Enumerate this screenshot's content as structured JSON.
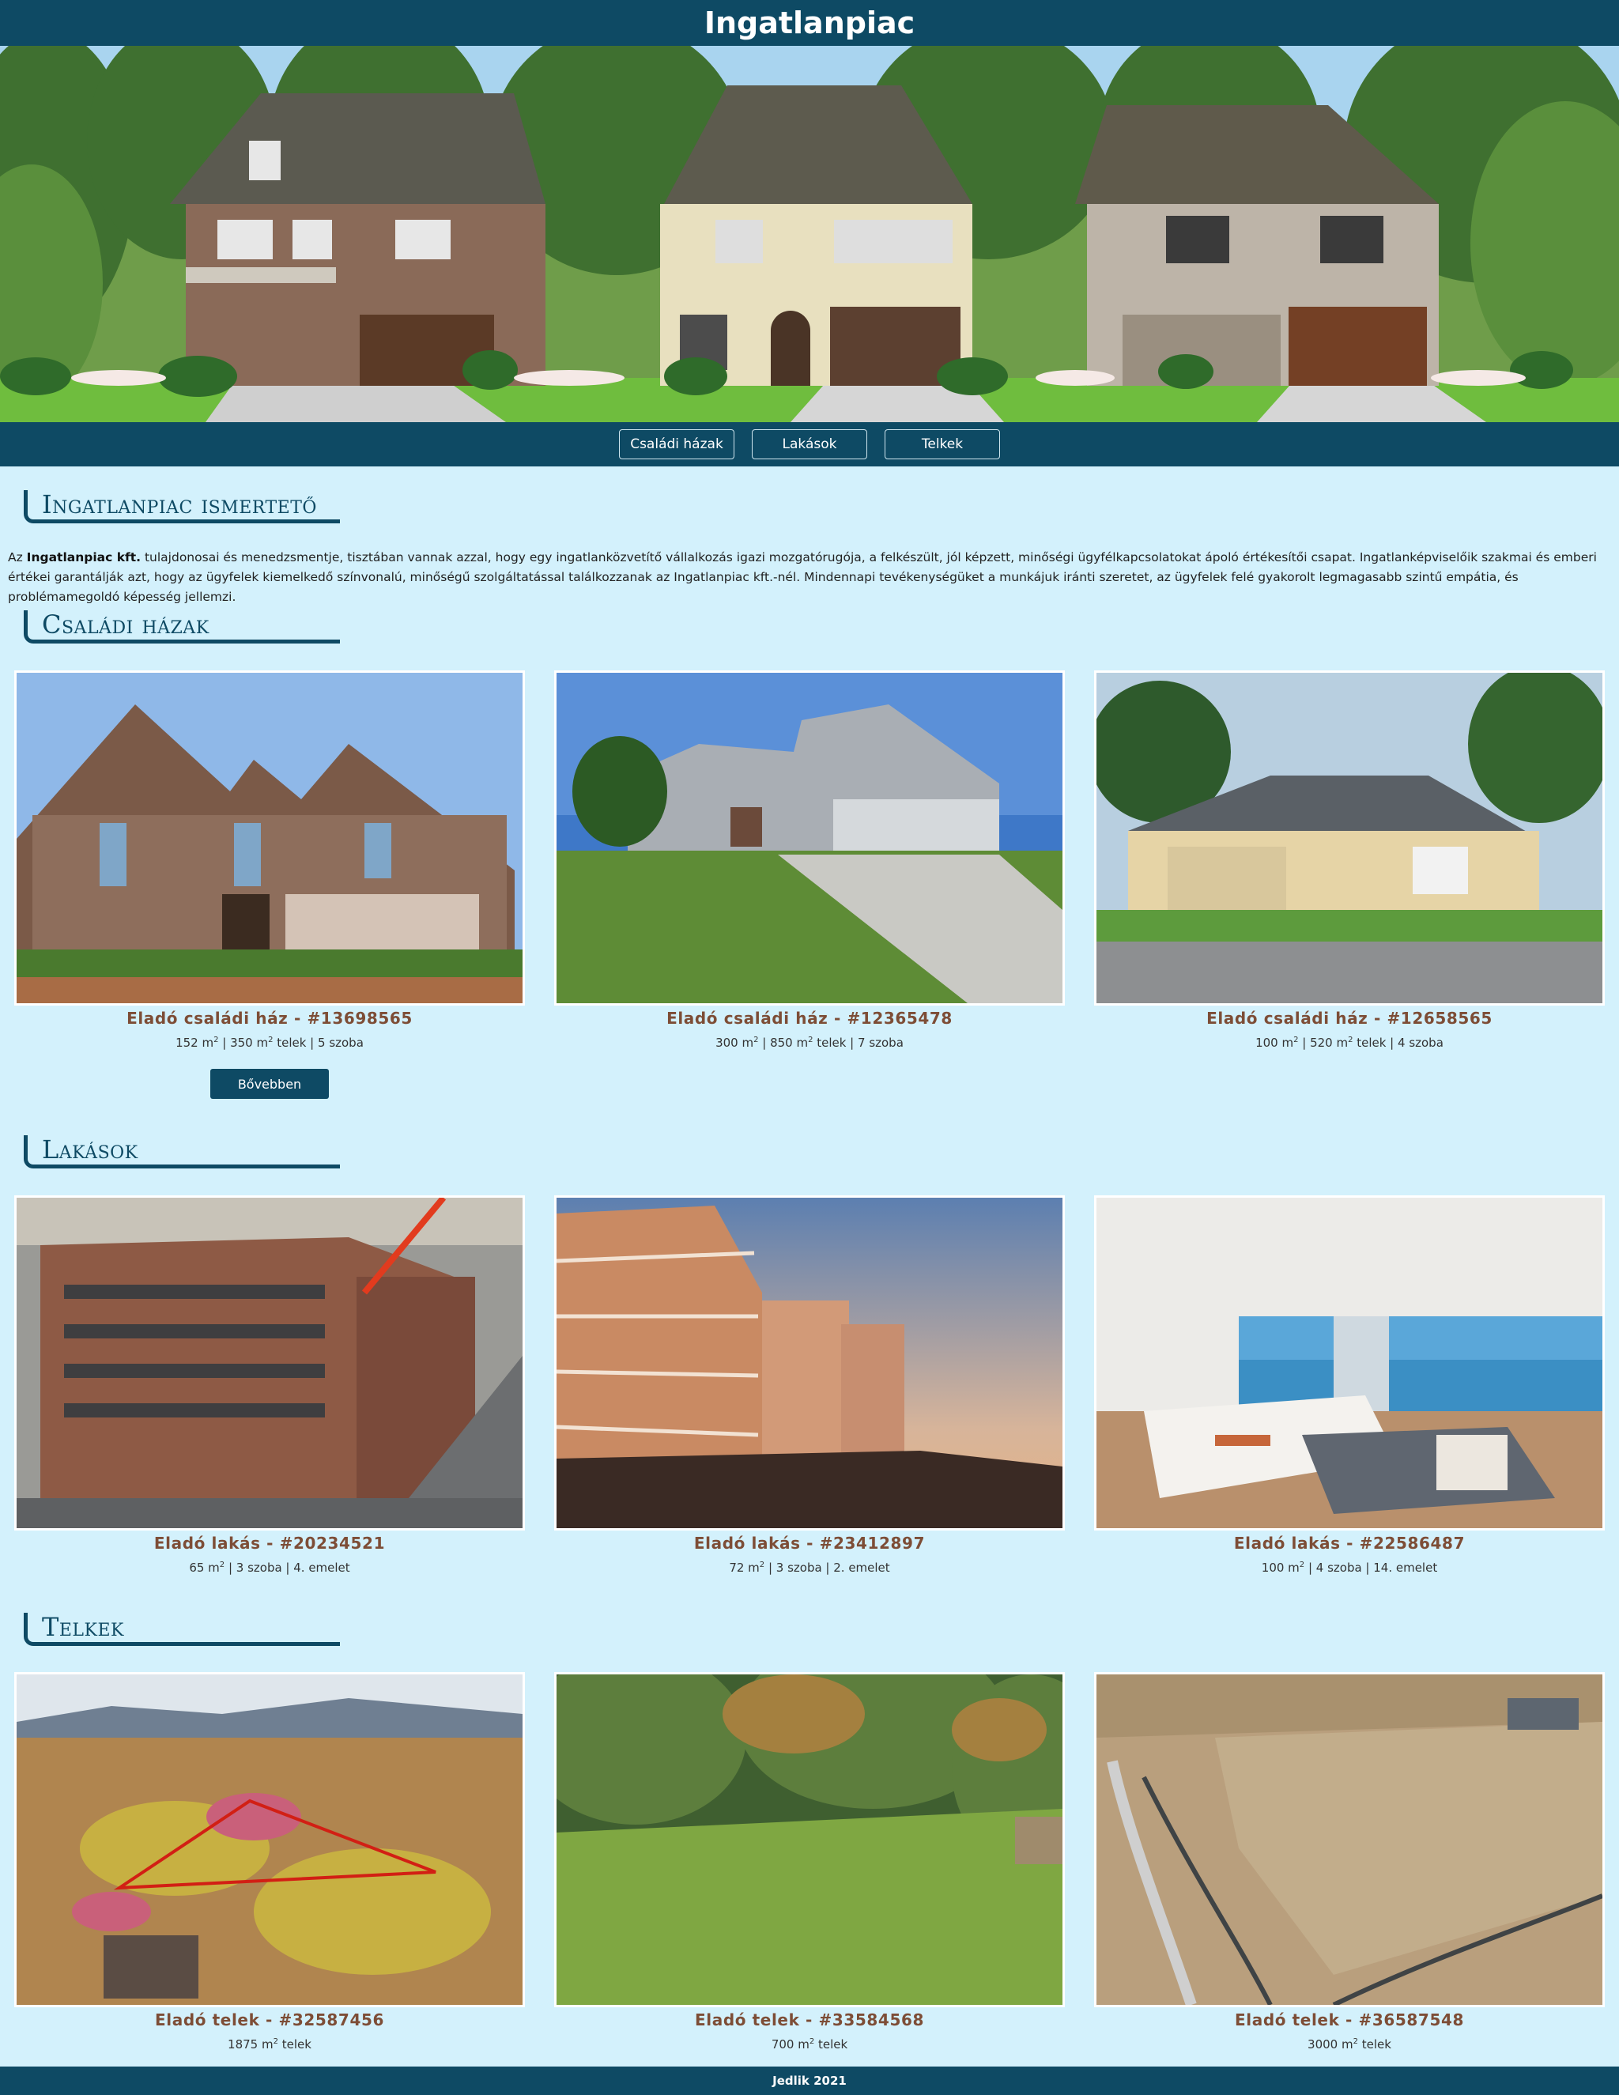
{
  "header": {
    "title": "Ingatlanpiac"
  },
  "nav": {
    "items": [
      {
        "label": "Családi házak"
      },
      {
        "label": "Lakások"
      },
      {
        "label": "Telkek"
      }
    ]
  },
  "intro": {
    "heading": "Ingatlanpiac ismertető",
    "text_prefix": "Az ",
    "company": "Ingatlanpiac kft.",
    "text_body": " tulajdonosai és menedzsmentje, tisztában vannak azzal, hogy egy ingatlanközvetítő vállalkozás igazi mozgatórugója, a felkészült, jól képzett, minőségi ügyfélkapcsolatokat ápoló értékesítői csapat. Ingatlanképviselőik szakmai és emberi értékei garantálják azt, hogy az ügyfelek kiemelkedő színvonalú, minőségű szolgáltatással találkozzanak az Ingatlanpiac kft.-nél. Mindennapi tevékenységüket a munkájuk iránti szeretet, az ügyfelek felé gyakorolt legmagasabb szintű empátia, és problémamegoldó képesség jellemzi."
  },
  "houses": {
    "heading": "Családi házak",
    "more_label": "Bővebben",
    "items": [
      {
        "title": "Eladó családi ház - #13698565",
        "area": "152 m",
        "lot": "350 m",
        "rest": " telek | 5 szoba"
      },
      {
        "title": "Eladó családi ház - #12365478",
        "area": "300 m",
        "lot": "850 m",
        "rest": " telek | 7 szoba"
      },
      {
        "title": "Eladó családi ház - #12658565",
        "area": "100 m",
        "lot": "520 m",
        "rest": " telek | 4 szoba"
      }
    ]
  },
  "flats": {
    "heading": "Lakások",
    "items": [
      {
        "title": "Eladó lakás - #20234521",
        "area": "65 m",
        "rest": " | 3 szoba | 4. emelet"
      },
      {
        "title": "Eladó lakás - #23412897",
        "area": "72 m",
        "rest": " | 3 szoba | 2. emelet"
      },
      {
        "title": "Eladó lakás - #22586487",
        "area": "100 m",
        "rest": " | 4 szoba | 14. emelet"
      }
    ]
  },
  "plots": {
    "heading": "Telkek",
    "items": [
      {
        "title": "Eladó telek - #32587456",
        "area": "1875 m",
        "rest": " telek"
      },
      {
        "title": "Eladó telek - #33584568",
        "area": "700 m",
        "rest": " telek"
      },
      {
        "title": "Eladó telek - #36587548",
        "area": "3000 m",
        "rest": " telek"
      }
    ]
  },
  "unit_sup": "2",
  "sep": " | ",
  "footer": {
    "text": "Jedlik 2021"
  }
}
